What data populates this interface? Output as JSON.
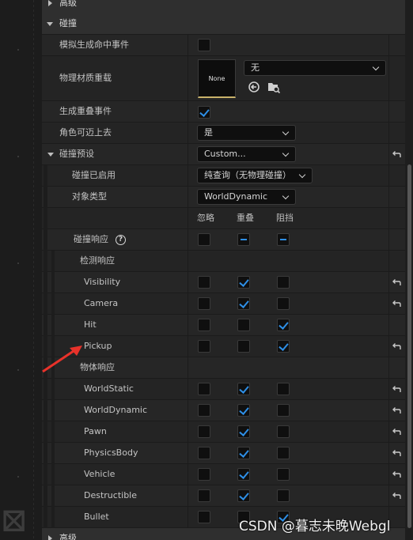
{
  "categories": {
    "advanced_top": "高级",
    "collision": "碰撞",
    "advanced_bottom": "高级"
  },
  "properties": {
    "simulation_hit_events": "模拟生成命中事件",
    "phys_material_override": "物理材质重载",
    "phys_material_value": "无",
    "phys_material_thumb": "None",
    "generate_overlap_events": "生成重叠事件",
    "can_character_step_up": "角色可迈上去",
    "can_character_step_up_value": "是",
    "collision_presets": "碰撞预设",
    "collision_presets_value": "Custom...",
    "collision_enabled": "碰撞已启用",
    "collision_enabled_value": "纯查询（无物理碰撞）",
    "object_type": "对象类型",
    "object_type_value": "WorldDynamic"
  },
  "response_headers": {
    "ignore": "忽略",
    "overlap": "重叠",
    "block": "阻挡"
  },
  "collision_responses_label": "碰撞响应",
  "trace_responses_label": "检测响应",
  "object_responses_label": "物体响应",
  "trace_channels": [
    {
      "name": "Visibility",
      "state": "overlap",
      "reset": true
    },
    {
      "name": "Camera",
      "state": "overlap",
      "reset": true
    },
    {
      "name": "Hit",
      "state": "block",
      "reset": false
    },
    {
      "name": "Pickup",
      "state": "block",
      "reset": true
    }
  ],
  "object_channels": [
    {
      "name": "WorldStatic",
      "state": "overlap",
      "reset": true
    },
    {
      "name": "WorldDynamic",
      "state": "overlap",
      "reset": true
    },
    {
      "name": "Pawn",
      "state": "overlap",
      "reset": true
    },
    {
      "name": "PhysicsBody",
      "state": "overlap",
      "reset": true
    },
    {
      "name": "Vehicle",
      "state": "overlap",
      "reset": true
    },
    {
      "name": "Destructible",
      "state": "overlap",
      "reset": true
    },
    {
      "name": "Bullet",
      "state": "block",
      "reset": false
    }
  ],
  "watermark": "CSDN @暮志未晚Webgl",
  "colors": {
    "accent": "#2e8fe6",
    "annotation_arrow": "#e8322a",
    "thumbnail_underline": "#c9b26a"
  }
}
